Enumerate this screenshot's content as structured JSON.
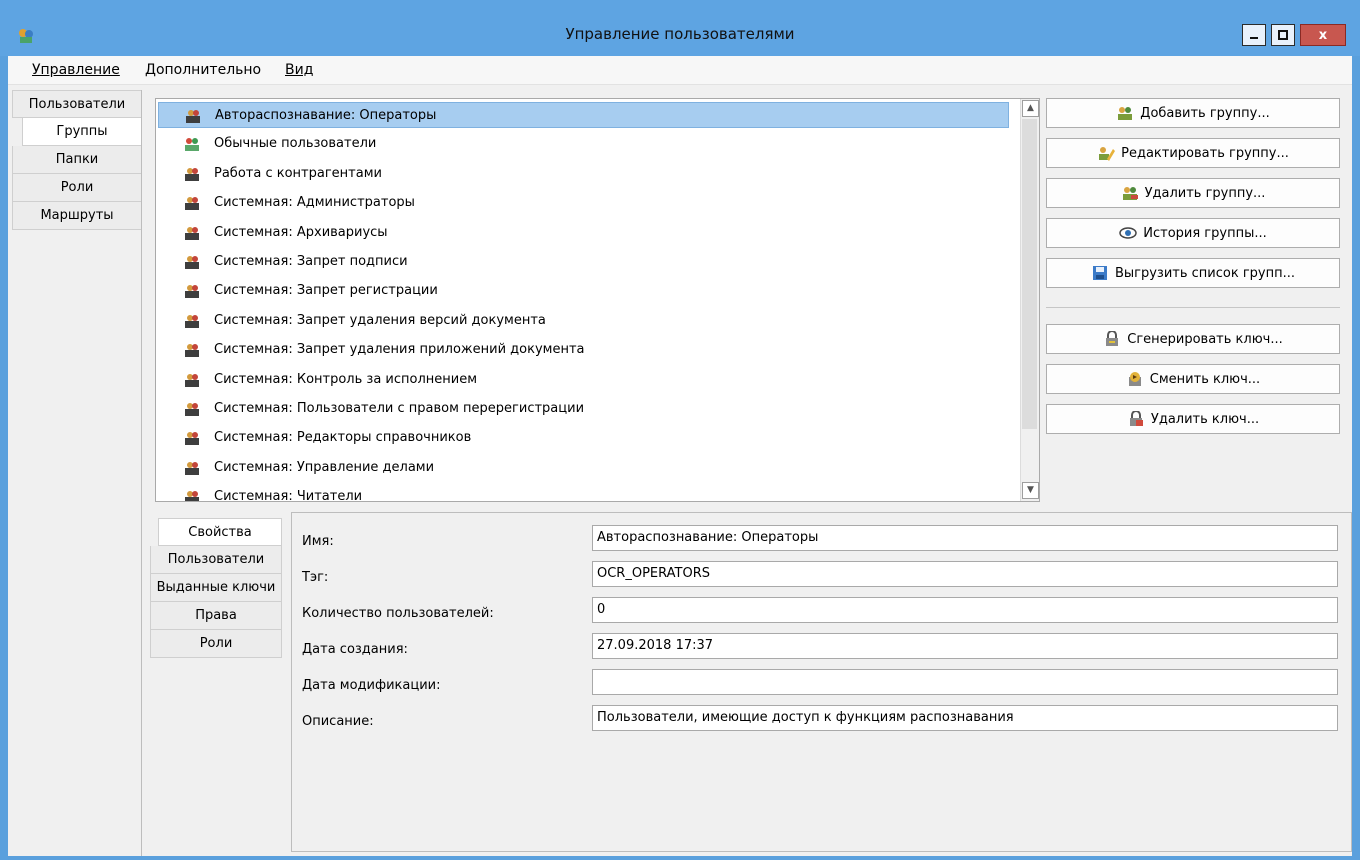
{
  "window": {
    "title": "Управление пользователями",
    "minimize_label": "_",
    "maximize_label": "□",
    "close_label": "x"
  },
  "menu": {
    "items": [
      {
        "label": "Управление"
      },
      {
        "label": "Дополнительно"
      },
      {
        "label": "Вид"
      }
    ]
  },
  "left_tabs": [
    {
      "label": "Пользователи",
      "active": false
    },
    {
      "label": "Группы",
      "active": true
    },
    {
      "label": "Папки",
      "active": false
    },
    {
      "label": "Роли",
      "active": false
    },
    {
      "label": "Маршруты",
      "active": false
    }
  ],
  "groups": {
    "selected_index": 0,
    "items": [
      {
        "label": "Автораспознавание: Операторы",
        "icon": "group-icon"
      },
      {
        "label": "Обычные пользователи",
        "icon": "users-group-icon"
      },
      {
        "label": "Работа с контрагентами",
        "icon": "group-icon"
      },
      {
        "label": "Системная: Администраторы",
        "icon": "group-icon"
      },
      {
        "label": "Системная: Архивариусы",
        "icon": "group-icon"
      },
      {
        "label": "Системная: Запрет подписи",
        "icon": "group-icon"
      },
      {
        "label": "Системная: Запрет регистрации",
        "icon": "group-icon"
      },
      {
        "label": "Системная: Запрет удаления версий документа",
        "icon": "group-icon"
      },
      {
        "label": "Системная: Запрет удаления приложений документа",
        "icon": "group-icon"
      },
      {
        "label": "Системная: Контроль за исполнением",
        "icon": "group-icon"
      },
      {
        "label": "Системная: Пользователи с правом перерегистрации",
        "icon": "group-icon"
      },
      {
        "label": "Системная: Редакторы справочников",
        "icon": "group-icon"
      },
      {
        "label": "Системная: Управление делами",
        "icon": "group-icon"
      },
      {
        "label": "Системная: Читатели",
        "icon": "group-icon"
      }
    ]
  },
  "actions": {
    "add_group": "Добавить группу...",
    "edit_group": "Редактировать группу...",
    "delete_group": "Удалить группу...",
    "group_history": "История группы...",
    "export_groups": "Выгрузить список групп...",
    "generate_key": "Сгенерировать ключ...",
    "change_key": "Сменить ключ...",
    "delete_key": "Удалить ключ..."
  },
  "detail_tabs": [
    {
      "label": "Свойства",
      "active": true
    },
    {
      "label": "Пользователи",
      "active": false
    },
    {
      "label": "Выданные ключи",
      "active": false
    },
    {
      "label": "Права",
      "active": false
    },
    {
      "label": "Роли",
      "active": false
    }
  ],
  "properties": {
    "name_label": "Имя:",
    "name_value": "Автораспознавание: Операторы",
    "tag_label": "Тэг:",
    "tag_value": "OCR_OPERATORS",
    "user_count_label": "Количество пользователей:",
    "user_count_value": "0",
    "created_label": "Дата создания:",
    "created_value": "27.09.2018 17:37",
    "modified_label": "Дата модификации:",
    "modified_value": "",
    "description_label": "Описание:",
    "description_value": "Пользователи, имеющие доступ к функциям распознавания"
  },
  "colors": {
    "titlebar": "#5ea4e2",
    "selection": "#a7cdf0",
    "close_button": "#c8574f"
  }
}
